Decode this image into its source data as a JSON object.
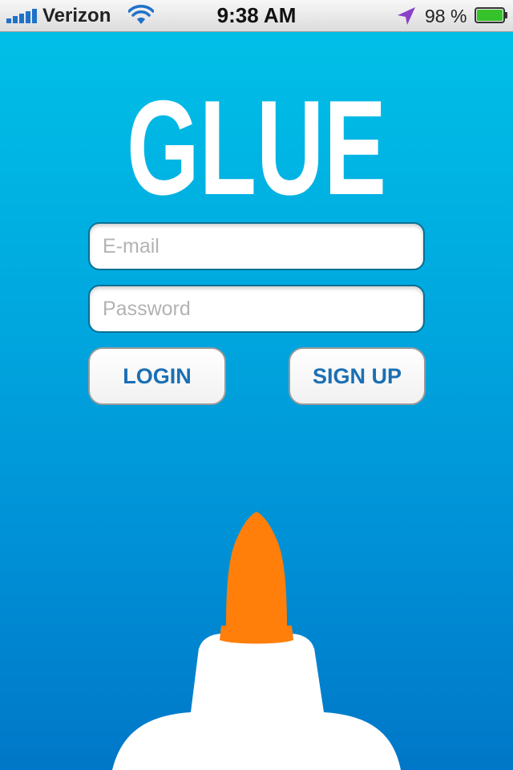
{
  "status_bar": {
    "carrier": "Verizon",
    "time": "9:38 AM",
    "battery_percent": "98 %",
    "battery_level": 0.98,
    "icons": [
      "signal-bars-icon",
      "wifi-icon",
      "location-arrow-icon",
      "battery-icon"
    ]
  },
  "logo": {
    "text": "GLUE"
  },
  "login_form": {
    "email_placeholder": "E-mail",
    "password_placeholder": "Password",
    "login_label": "LOGIN",
    "signup_label": "SIGN UP"
  },
  "colors": {
    "background_top": "#00c2e8",
    "background_bottom": "#0077c8",
    "button_text": "#1a6fb4",
    "cap": "#ff7f0a",
    "bottle": "#ffffff"
  }
}
